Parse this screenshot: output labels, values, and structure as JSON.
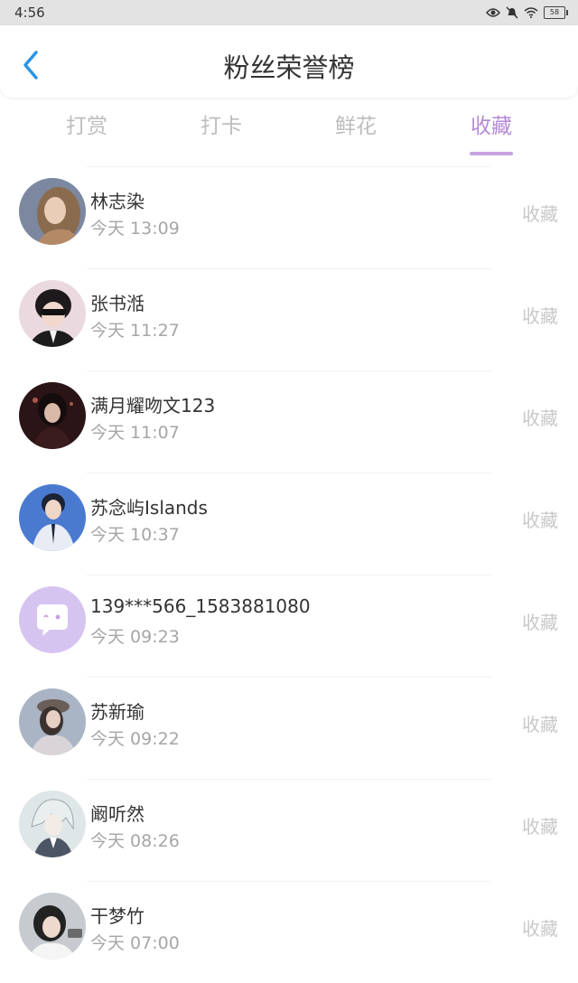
{
  "status_bar": {
    "time": "4:56",
    "icons": [
      "eye-icon",
      "mute-icon",
      "wifi-icon",
      "battery-icon"
    ],
    "battery": "58"
  },
  "header": {
    "title": "粉丝荣誉榜",
    "back_icon": "chevron-left-icon"
  },
  "tabs": [
    {
      "label": "打赏",
      "active": false
    },
    {
      "label": "打卡",
      "active": false
    },
    {
      "label": "鲜花",
      "active": false
    },
    {
      "label": "收藏",
      "active": true
    }
  ],
  "colors": {
    "accent": "#b58ad6",
    "back_icon": "#2b95e6",
    "muted": "#a6a6a6"
  },
  "list": [
    {
      "name": "林志染",
      "time": "今天 13:09",
      "action": "收藏",
      "avatar": "avatar-photo"
    },
    {
      "name": "张书湉",
      "time": "今天 11:27",
      "action": "收藏",
      "avatar": "avatar-photo"
    },
    {
      "name": "满月耀吻文123",
      "time": "今天 11:07",
      "action": "收藏",
      "avatar": "avatar-photo"
    },
    {
      "name": "苏念屿Islands",
      "time": "今天 10:37",
      "action": "收藏",
      "avatar": "avatar-photo"
    },
    {
      "name": "139***566_1583881080",
      "time": "今天 09:23",
      "action": "收藏",
      "avatar": "default-chat-avatar-icon"
    },
    {
      "name": "苏新瑜",
      "time": "今天 09:22",
      "action": "收藏",
      "avatar": "avatar-photo"
    },
    {
      "name": "阚听然",
      "time": "今天 08:26",
      "action": "收藏",
      "avatar": "avatar-photo"
    },
    {
      "name": "干梦竹",
      "time": "今天 07:00",
      "action": "收藏",
      "avatar": "avatar-photo"
    }
  ]
}
